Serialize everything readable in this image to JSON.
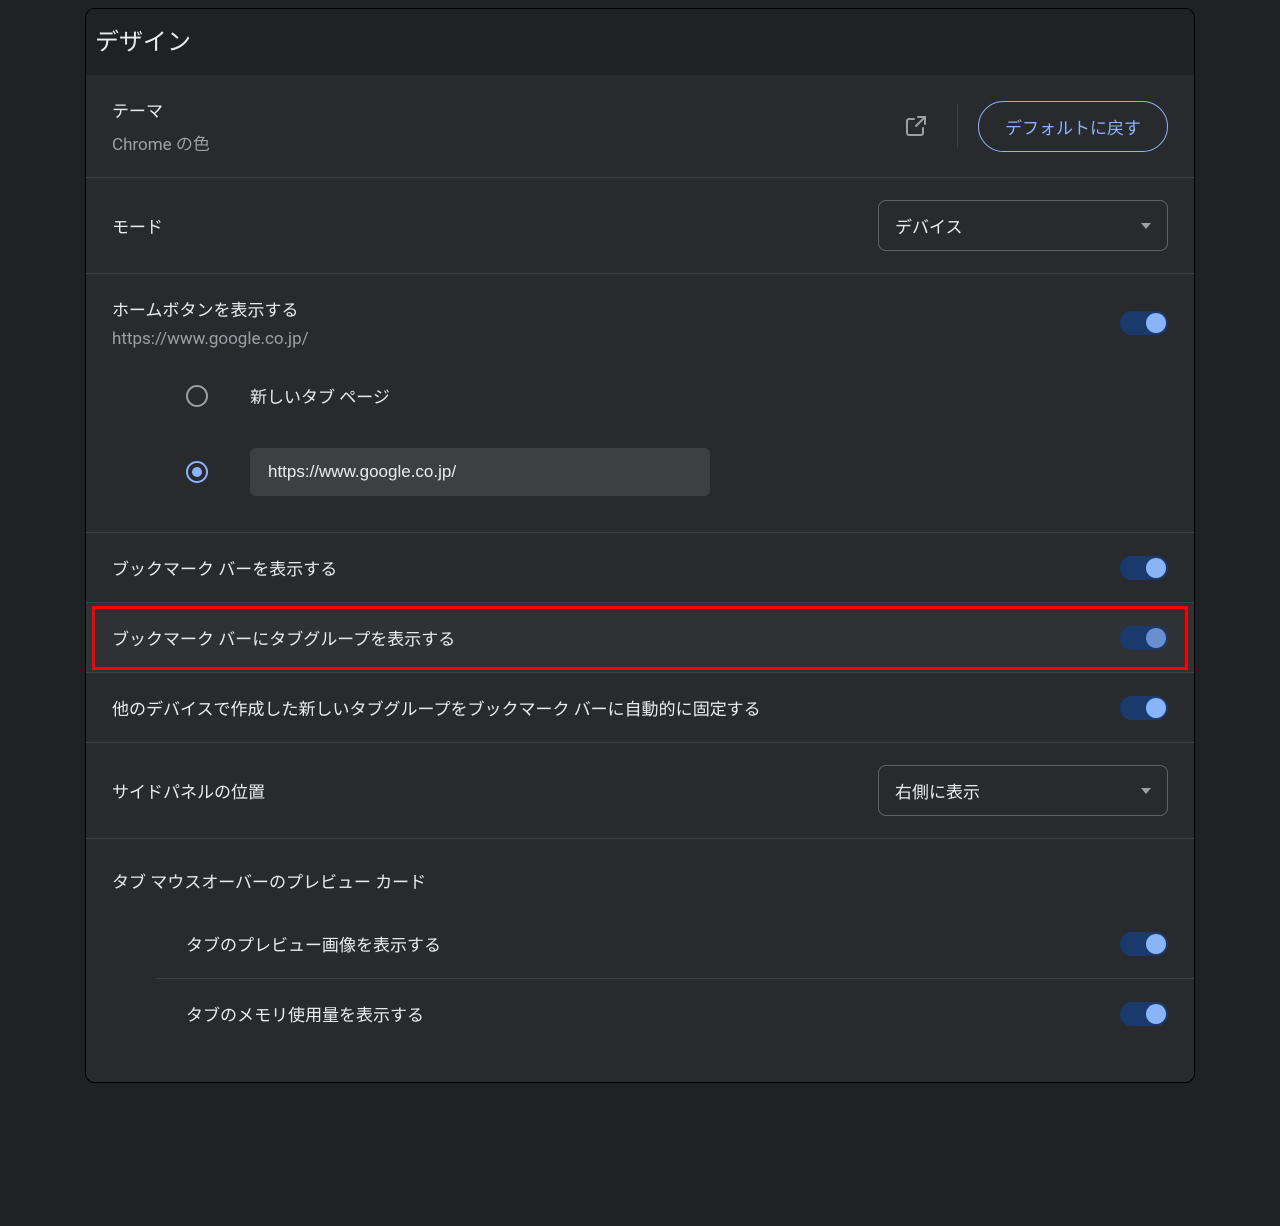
{
  "page": {
    "title": "デザイン"
  },
  "theme": {
    "label": "テーマ",
    "subtitle": "Chrome の色",
    "reset_button": "デフォルトに戻す"
  },
  "mode": {
    "label": "モード",
    "value": "デバイス"
  },
  "home_button": {
    "label": "ホームボタンを表示する",
    "subtitle": "https://www.google.co.jp/",
    "enabled": true,
    "option_new_tab": "新しいタブ ページ",
    "option_custom_url": "https://www.google.co.jp/",
    "selected": "custom"
  },
  "bookmark_bar": {
    "label": "ブックマーク バーを表示する",
    "enabled": true
  },
  "bookmark_tab_groups": {
    "label": "ブックマーク バーにタブグループを表示する",
    "enabled": true
  },
  "auto_pin_tab_groups": {
    "label": "他のデバイスで作成した新しいタブグループをブックマーク バーに自動的に固定する",
    "enabled": true
  },
  "side_panel": {
    "label": "サイドパネルの位置",
    "value": "右側に表示"
  },
  "tab_hover": {
    "label": "タブ マウスオーバーのプレビュー カード",
    "preview_image": {
      "label": "タブのプレビュー画像を表示する",
      "enabled": true
    },
    "memory_usage": {
      "label": "タブのメモリ使用量を表示する",
      "enabled": true
    }
  }
}
